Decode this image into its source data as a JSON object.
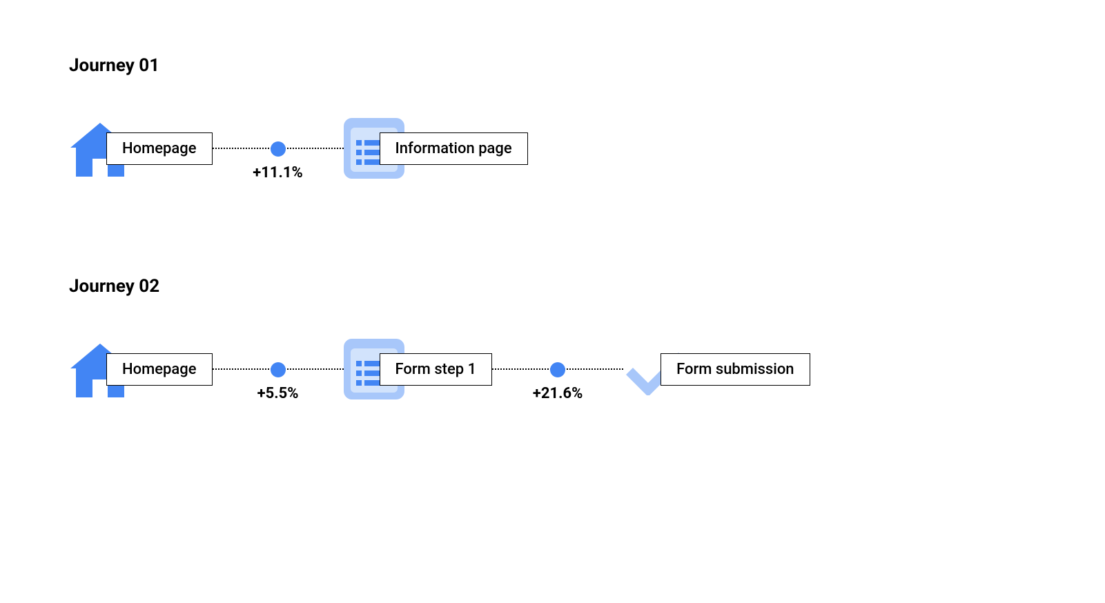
{
  "journeys": [
    {
      "title": "Journey 01",
      "nodes": [
        {
          "icon": "home",
          "label": "Homepage"
        },
        {
          "icon": "page",
          "label": "Information page"
        }
      ],
      "connectors": [
        {
          "label": "+11.1%"
        }
      ]
    },
    {
      "title": "Journey 02",
      "nodes": [
        {
          "icon": "home",
          "label": "Homepage"
        },
        {
          "icon": "page",
          "label": "Form step 1"
        },
        {
          "icon": "check",
          "label": "Form submission"
        }
      ],
      "connectors": [
        {
          "label": "+5.5%"
        },
        {
          "label": "+21.6%"
        }
      ]
    }
  ],
  "colors": {
    "primary": "#4285f4",
    "light": "#a8c7fa",
    "lighter": "#d2e3fc"
  }
}
